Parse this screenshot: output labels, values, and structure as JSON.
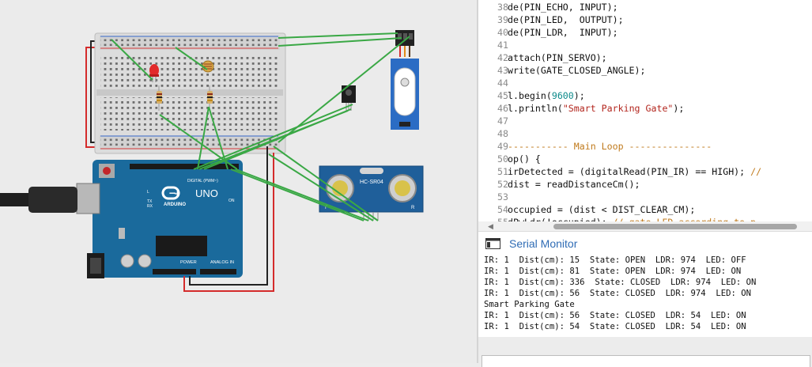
{
  "code_editor": {
    "lines": [
      {
        "n": "38",
        "parts": [
          {
            "t": "de(PIN_ECHO, INPUT);",
            "c": ""
          }
        ]
      },
      {
        "n": "39",
        "parts": [
          {
            "t": "de(PIN_LED,  OUTPUT);",
            "c": ""
          }
        ]
      },
      {
        "n": "40",
        "parts": [
          {
            "t": "de(PIN_LDR,  INPUT);",
            "c": ""
          }
        ]
      },
      {
        "n": "41",
        "parts": []
      },
      {
        "n": "42",
        "parts": [
          {
            "t": "attach(PIN_SERVO);",
            "c": ""
          }
        ]
      },
      {
        "n": "43",
        "parts": [
          {
            "t": "write(GATE_CLOSED_ANGLE);",
            "c": ""
          }
        ]
      },
      {
        "n": "44",
        "parts": []
      },
      {
        "n": "45",
        "parts": [
          {
            "t": "l.begin(",
            "c": ""
          },
          {
            "t": "9600",
            "c": "num"
          },
          {
            "t": ");",
            "c": ""
          }
        ]
      },
      {
        "n": "46",
        "parts": [
          {
            "t": "l.println(",
            "c": ""
          },
          {
            "t": "\"Smart Parking Gate\"",
            "c": "str"
          },
          {
            "t": ");",
            "c": ""
          }
        ]
      },
      {
        "n": "47",
        "parts": []
      },
      {
        "n": "48",
        "parts": []
      },
      {
        "n": "49",
        "parts": [
          {
            "t": "----------- Main Loop ---------------",
            "c": "cmt"
          }
        ]
      },
      {
        "n": "50",
        "parts": [
          {
            "t": "op() {",
            "c": ""
          }
        ]
      },
      {
        "n": "51",
        "parts": [
          {
            "t": "irDetected = (digitalRead(PIN_IR) == HIGH); ",
            "c": ""
          },
          {
            "t": "//",
            "c": "cmt"
          }
        ]
      },
      {
        "n": "52",
        "parts": [
          {
            "t": "dist = readDistanceCm();",
            "c": ""
          }
        ]
      },
      {
        "n": "53",
        "parts": []
      },
      {
        "n": "54",
        "parts": [
          {
            "t": "occupied = (dist < DIST_CLEAR_CM);",
            "c": ""
          }
        ]
      },
      {
        "n": "55",
        "parts": [
          {
            "t": "dPwLdr(!occupied); ",
            "c": ""
          },
          {
            "t": "// gate LED according to p",
            "c": "cmt"
          }
        ]
      }
    ]
  },
  "serial_monitor": {
    "title": "Serial Monitor",
    "lines": [
      "IR: 1  Dist(cm): 15  State: OPEN  LDR: 974  LED: OFF",
      "IR: 1  Dist(cm): 81  State: OPEN  LDR: 974  LED: ON",
      "IR: 1  Dist(cm): 336  State: CLOSED  LDR: 974  LED: ON",
      "IR: 1  Dist(cm): 56  State: CLOSED  LDR: 974  LED: ON",
      "Smart Parking Gate",
      "IR: 1  Dist(cm): 56  State: CLOSED  LDR: 54  LED: ON",
      "IR: 1  Dist(cm): 54  State: CLOSED  LDR: 54  LED: ON"
    ],
    "input_value": ""
  },
  "circuit": {
    "arduino": {
      "brand": "ARDUINO",
      "model": "UNO",
      "power_label": "POWER",
      "analog_label": "ANALOG IN",
      "digital_label": "DIGITAL (PWM~)",
      "on_label": "ON",
      "tx_label": "TX",
      "rx_label": "RX",
      "l_label": "L"
    },
    "sensor_label": "HC-SR04",
    "sensor_pin_labels": [
      "T",
      "R"
    ]
  },
  "colors": {
    "wire_green": "#3aa845",
    "wire_red": "#d42b2b",
    "arduino_blue": "#1a6a9c",
    "link_blue": "#2f6cb5"
  }
}
